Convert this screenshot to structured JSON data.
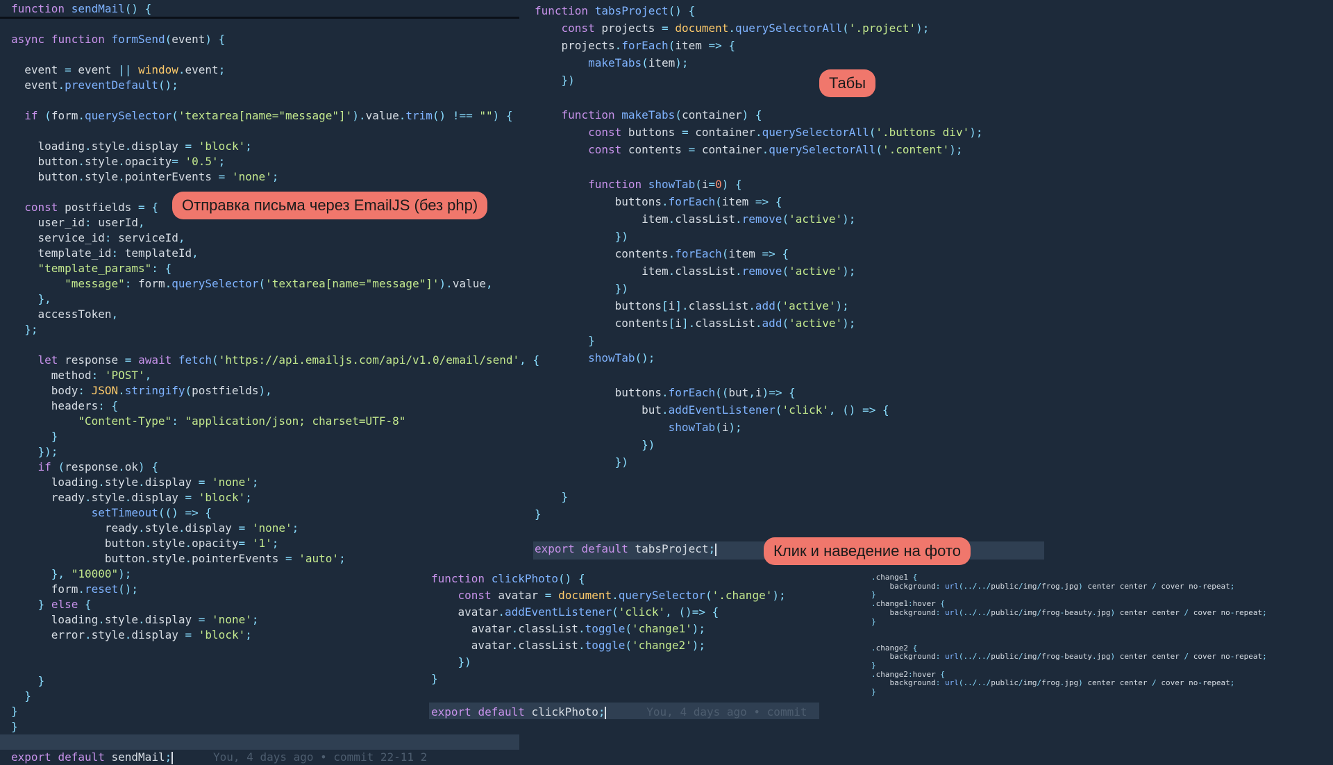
{
  "send_mail": {
    "lines": [
      "function sendMail() {",
      "",
      "async function formSend(event) {",
      "",
      "  event = event || window.event;",
      "  event.preventDefault();",
      "",
      "  if (form.querySelector('textarea[name=\"message\"]').value.trim() !== \"\") {",
      "",
      "    loading.style.display = 'block';",
      "    button.style.opacity= '0.5';",
      "    button.style.pointerEvents = 'none';",
      "",
      "  const postfields = {",
      "    user_id: userId,",
      "    service_id: serviceId,",
      "    template_id: templateId,",
      "    \"template_params\": {",
      "        \"message\": form.querySelector('textarea[name=\"message\"]').value,",
      "    },",
      "    accessToken,",
      "  };",
      "",
      "    let response = await fetch('https://api.emailjs.com/api/v1.0/email/send', {",
      "      method: 'POST',",
      "      body: JSON.stringify(postfields),",
      "      headers: {",
      "          \"Content-Type\": \"application/json; charset=UTF-8\"",
      "      }",
      "    });",
      "    if (response.ok) {",
      "      loading.style.display = 'none';",
      "      ready.style.display = 'block';",
      "            setTimeout(() => {",
      "              ready.style.display = 'none';",
      "              button.style.opacity= '1';",
      "              button.style.pointerEvents = 'auto';",
      "      }, \"10000\");",
      "      form.reset();",
      "    } else {",
      "      loading.style.display = 'none';",
      "      error.style.display = 'block';",
      "",
      "",
      "    }",
      "  }",
      "}",
      "}",
      "",
      "export default sendMail;"
    ],
    "blame": "You, 4 days ago • commit 22-11 2"
  },
  "tabs_project": {
    "lines": [
      "function tabsProject() {",
      "    const projects = document.querySelectorAll('.project');",
      "    projects.forEach(item => {",
      "        makeTabs(item);",
      "    })",
      "",
      "    function makeTabs(container) {",
      "        const buttons = container.querySelectorAll('.buttons div');",
      "        const contents = container.querySelectorAll('.content');",
      "",
      "        function showTab(i=0) {",
      "            buttons.forEach(item => {",
      "                item.classList.remove('active');",
      "            })",
      "            contents.forEach(item => {",
      "                item.classList.remove('active');",
      "            })",
      "            buttons[i].classList.add('active');",
      "            contents[i].classList.add('active');",
      "        }",
      "        showTab();",
      "",
      "            buttons.forEach((but,i)=> {",
      "                but.addEventListener('click', () => {",
      "                    showTab(i);",
      "                })",
      "            })",
      "",
      "    }",
      "}",
      "",
      "export default tabsProject;"
    ]
  },
  "click_photo": {
    "lines": [
      "function clickPhoto() {",
      "    const avatar = document.querySelector('.change');",
      "    avatar.addEventListener('click', ()=> {",
      "      avatar.classList.toggle('change1');",
      "      avatar.classList.toggle('change2');",
      "    })",
      "}",
      "",
      "export default clickPhoto;"
    ],
    "blame": "You, 4 days ago • commit"
  },
  "css_snippet": {
    "lines": [
      ".change1 {",
      "    background: url(../../public/img/frog.jpg) center center / cover no-repeat;",
      "}",
      ".change1:hover {",
      "    background: url(../../public/img/frog-beauty.jpg) center center / cover no-repeat;",
      "}",
      "",
      "",
      ".change2 {",
      "    background: url(../../public/img/frog-beauty.jpg) center center / cover no-repeat;",
      "}",
      ".change2:hover {",
      "    background: url(../../public/img/frog.jpg) center center / cover no-repeat;",
      "}"
    ]
  },
  "labels": {
    "email": "Отправка письма через EmailJS (без php)",
    "tabs": "Табы",
    "photo": "Клик и наведение на фото"
  },
  "colors": {
    "background": "#1d2a3a",
    "badge": "#f0776c"
  }
}
